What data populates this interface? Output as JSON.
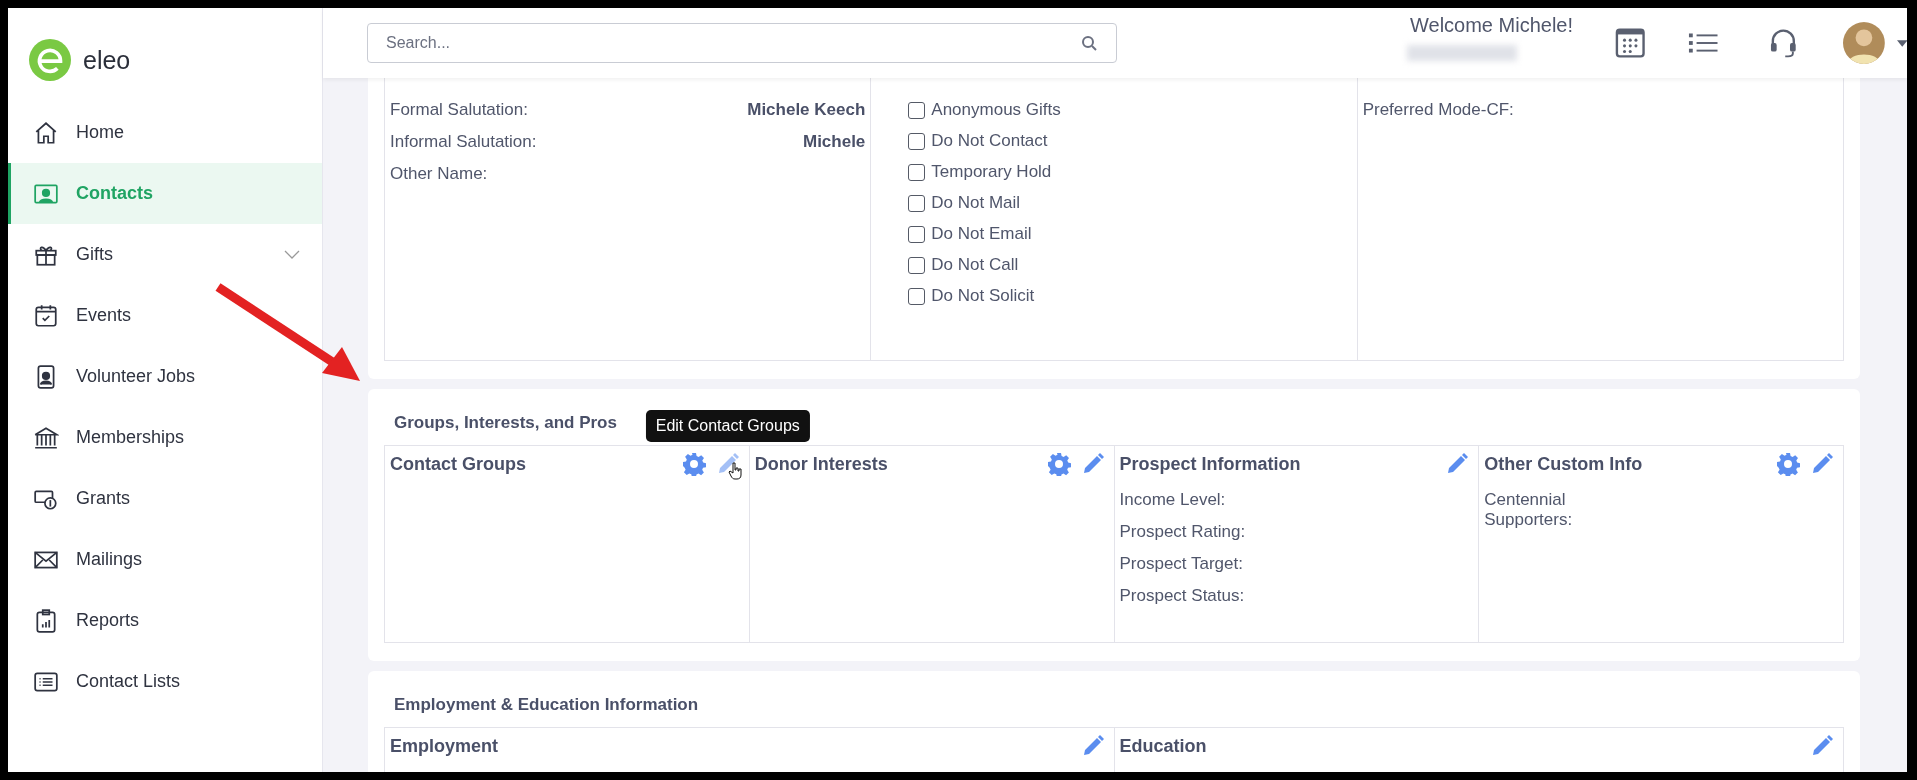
{
  "logo": {
    "text": "eleo"
  },
  "sidebar": {
    "items": [
      {
        "label": "Home",
        "selected": false,
        "expandable": false
      },
      {
        "label": "Contacts",
        "selected": true,
        "expandable": false
      },
      {
        "label": "Gifts",
        "selected": false,
        "expandable": true
      },
      {
        "label": "Events",
        "selected": false,
        "expandable": false
      },
      {
        "label": "Volunteer Jobs",
        "selected": false,
        "expandable": false
      },
      {
        "label": "Memberships",
        "selected": false,
        "expandable": false
      },
      {
        "label": "Grants",
        "selected": false,
        "expandable": false
      },
      {
        "label": "Mailings",
        "selected": false,
        "expandable": false
      },
      {
        "label": "Reports",
        "selected": false,
        "expandable": false
      },
      {
        "label": "Contact Lists",
        "selected": false,
        "expandable": false
      }
    ]
  },
  "header": {
    "search": {
      "placeholder": "Search..."
    },
    "welcome": "Welcome Michele!"
  },
  "sections": [
    {
      "columns": [
        {
          "kind": "fields",
          "fields": [
            {
              "label": "Formal Salutation:",
              "value": "Michele Keech"
            },
            {
              "label": "Informal Salutation:",
              "value": "Michele"
            },
            {
              "label": "Other Name:"
            }
          ]
        },
        {
          "kind": "checkboxes",
          "checkboxes": [
            {
              "label": "Anonymous Gifts",
              "checked": false
            },
            {
              "label": "Do Not Contact",
              "checked": false
            },
            {
              "label": "Temporary Hold",
              "checked": false
            },
            {
              "label": "Do Not Mail",
              "checked": false
            },
            {
              "label": "Do Not Email",
              "checked": false
            },
            {
              "label": "Do Not Call",
              "checked": false
            },
            {
              "label": "Do Not Solicit",
              "checked": false
            }
          ]
        },
        {
          "kind": "fields",
          "fields": [
            {
              "label": "Preferred Mode-CF:"
            }
          ]
        }
      ]
    },
    {
      "title": "Groups, Interests, and Pros",
      "columns": [
        {
          "kind": "fields",
          "heading": "Contact Groups",
          "settings": true,
          "edit": true,
          "hovered": true,
          "tooltip": "Edit Contact Groups"
        },
        {
          "kind": "fields",
          "heading": "Donor Interests",
          "settings": true,
          "edit": true,
          "hovered": false
        },
        {
          "kind": "fields",
          "heading": "Prospect Information",
          "settings": false,
          "edit": true,
          "hovered": false,
          "fields": [
            {
              "label": "Income Level:"
            },
            {
              "label": "Prospect Rating:"
            },
            {
              "label": "Prospect Target:"
            },
            {
              "label": "Prospect Status:"
            }
          ]
        },
        {
          "kind": "fields",
          "heading": "Other Custom Info",
          "settings": true,
          "edit": true,
          "hovered": false,
          "fields": [
            {
              "label": "Centennial Supporters:"
            }
          ]
        }
      ]
    },
    {
      "title": "Employment & Education Information",
      "columns": [
        {
          "kind": "fields",
          "heading": "Employment",
          "settings": false,
          "edit": true,
          "hovered": false
        },
        {
          "kind": "fields",
          "heading": "Education",
          "settings": false,
          "edit": true,
          "hovered": false
        }
      ]
    }
  ]
}
